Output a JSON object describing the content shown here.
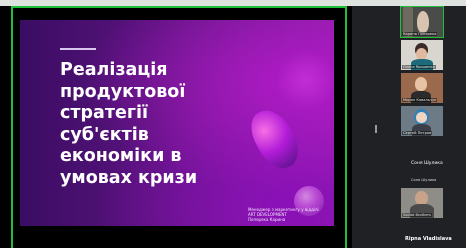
{
  "slide": {
    "title_lines": [
      "Реалізація",
      "продуктової",
      "стратегії",
      "суб'єктів",
      "економіки в",
      "умовах кризи"
    ],
    "caption_lines": [
      "Менеджер з маркетингу у відділі",
      "ART DEVELOPMENT",
      "Поперека Карина"
    ]
  },
  "participants": [
    {
      "name": "Карина Поперека",
      "active": true
    },
    {
      "name": "Олеся Ярошенко"
    },
    {
      "name": "Мирон Ковальчук"
    },
    {
      "name": "Сергей Петров"
    },
    {
      "name": "Соня Шулика",
      "display": "Соня Шулика",
      "sub": "Соня Шулика"
    },
    {
      "name": "Soldat Brothers"
    },
    {
      "name": "Ripna Vladislava"
    }
  ],
  "colors": {
    "active_speaker": "#1fbf3a",
    "slide_bg": "#5c137f"
  }
}
